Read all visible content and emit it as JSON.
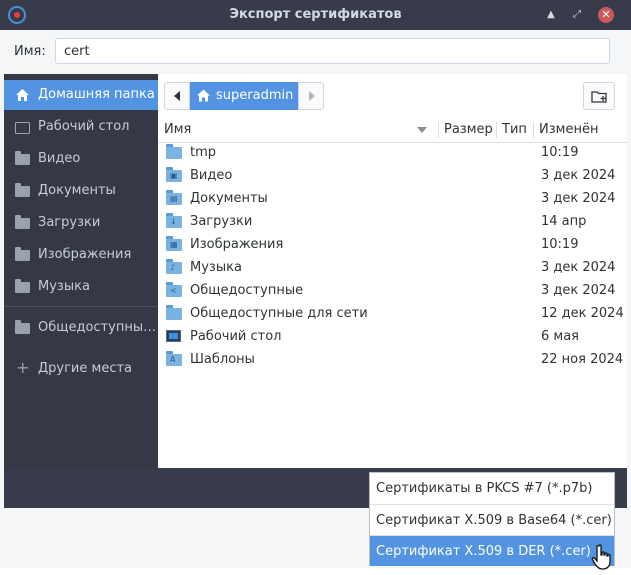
{
  "window": {
    "title": "Экспорт сертификатов"
  },
  "name_field": {
    "label": "Имя:",
    "value": "cert"
  },
  "sidebar": {
    "items": [
      {
        "label": "Домашняя папка",
        "icon": "home-icon",
        "active": true
      },
      {
        "label": "Рабочий стол",
        "icon": "folder-outline-icon"
      },
      {
        "label": "Видео",
        "icon": "folder-icon"
      },
      {
        "label": "Документы",
        "icon": "folder-icon"
      },
      {
        "label": "Загрузки",
        "icon": "folder-icon"
      },
      {
        "label": "Изображения",
        "icon": "folder-icon"
      },
      {
        "label": "Музыка",
        "icon": "folder-icon"
      },
      {
        "label": "Общедоступны…",
        "icon": "folder-icon"
      },
      {
        "label": "Другие места",
        "icon": "plus-icon"
      }
    ]
  },
  "pathbar": {
    "current": "superadmin"
  },
  "columns": {
    "name": "Имя",
    "size": "Размер",
    "type": "Тип",
    "modified": "Изменён"
  },
  "files": [
    {
      "name": "tmp",
      "modified": "10:19",
      "icon": "folder-icon"
    },
    {
      "name": "Видео",
      "modified": "3 дек 2024",
      "icon": "folder-video-icon"
    },
    {
      "name": "Документы",
      "modified": "3 дек 2024",
      "icon": "folder-documents-icon"
    },
    {
      "name": "Загрузки",
      "modified": "14 апр",
      "icon": "folder-download-icon"
    },
    {
      "name": "Изображения",
      "modified": "10:19",
      "icon": "folder-pictures-icon"
    },
    {
      "name": "Музыка",
      "modified": "3 дек 2024",
      "icon": "folder-music-icon"
    },
    {
      "name": "Общедоступные",
      "modified": "3 дек 2024",
      "icon": "folder-share-icon"
    },
    {
      "name": "Общедоступные для сети",
      "modified": "12 дек 2024",
      "icon": "folder-icon"
    },
    {
      "name": "Рабочий стол",
      "modified": "6 мая",
      "icon": "desktop-icon"
    },
    {
      "name": "Шаблоны",
      "modified": "22 ноя 2024",
      "icon": "folder-templates-icon"
    }
  ],
  "format_dropdown": {
    "options": [
      "Сертификаты в PKCS #7 (*.p7b)",
      "Сертификат X.509 в Base64 (*.cer)",
      "Сертификат X.509 в DER (*.cer)"
    ],
    "selected_index": 2
  },
  "colors": {
    "accent": "#5294e2",
    "titlebar": "#383c4a",
    "sidebar": "#353945",
    "close": "#cc575d"
  }
}
